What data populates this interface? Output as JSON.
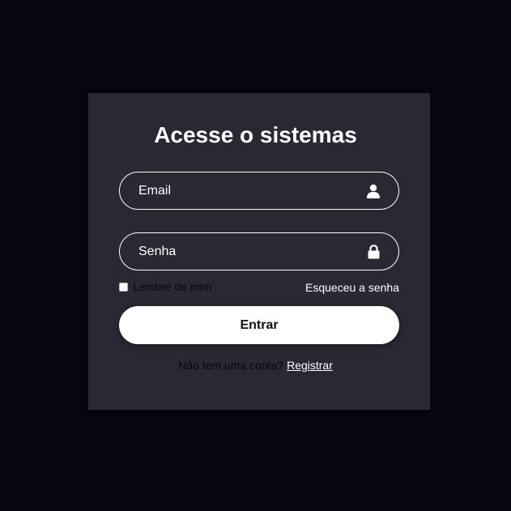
{
  "form": {
    "title": "Acesse o sistemas",
    "email": {
      "placeholder": "Email",
      "icon": "user-icon"
    },
    "password": {
      "placeholder": "Senha",
      "icon": "lock-icon"
    },
    "remember_label": "Lembre de mim",
    "forgot_label": "Esqueceu a senha",
    "submit_label": "Entrar",
    "register_prompt": "Não tem uma conta?",
    "register_link": "Registrar"
  },
  "colors": {
    "background": "#050510",
    "card": "#282933",
    "text": "#ffffff"
  }
}
